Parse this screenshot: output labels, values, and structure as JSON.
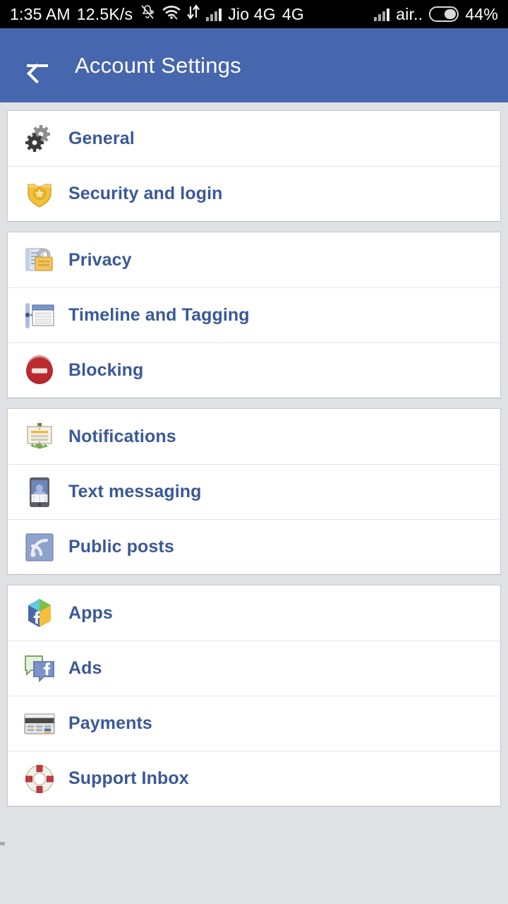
{
  "statusbar": {
    "time": "1:35 AM",
    "data_rate": "12.5K/s",
    "icons": [
      "bell-muted-icon",
      "wifi-icon",
      "data-transfer-icon",
      "signal-bars-icon"
    ],
    "carrier_1": "Jio 4G",
    "network_type": "4G",
    "carrier_2": "air..",
    "battery_percent": "44%"
  },
  "appbar": {
    "back_icon": "back-arrow-icon",
    "title": "Account Settings",
    "background": "#4666ad"
  },
  "theme": {
    "link_blue": "#3b5998",
    "page_background": "#dfe1e5",
    "card_background": "#ffffff",
    "divider": "#e3e5e8"
  },
  "groups": [
    {
      "name": "account-group",
      "items": [
        {
          "label": "General",
          "icon": "gears-icon"
        },
        {
          "label": "Security and login",
          "icon": "shield-badge-icon"
        }
      ]
    },
    {
      "name": "privacy-group",
      "items": [
        {
          "label": "Privacy",
          "icon": "padlock-document-icon"
        },
        {
          "label": "Timeline and Tagging",
          "icon": "timeline-icon"
        },
        {
          "label": "Blocking",
          "icon": "block-circle-icon"
        }
      ]
    },
    {
      "name": "communication-group",
      "items": [
        {
          "label": "Notifications",
          "icon": "signpost-icon"
        },
        {
          "label": "Text messaging",
          "icon": "mobile-phone-icon"
        },
        {
          "label": "Public posts",
          "icon": "rss-feed-icon"
        }
      ]
    },
    {
      "name": "services-group",
      "items": [
        {
          "label": "Apps",
          "icon": "cube-facebook-icon"
        },
        {
          "label": "Ads",
          "icon": "speech-bubbles-facebook-icon"
        },
        {
          "label": "Payments",
          "icon": "credit-card-icon"
        },
        {
          "label": "Support Inbox",
          "icon": "life-ring-icon"
        }
      ]
    }
  ]
}
